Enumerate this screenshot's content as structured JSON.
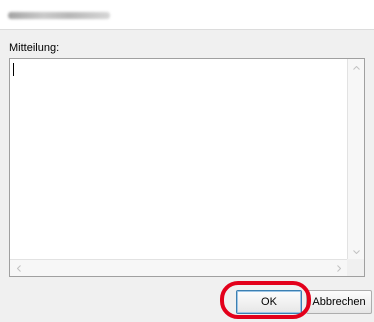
{
  "message_label": "Mitteilung:",
  "message_text": "",
  "buttons": {
    "ok_label": "OK",
    "cancel_label": "Abbrechen"
  },
  "colors": {
    "highlight": "#e3001b",
    "dialog_bg": "#f0f0f0"
  },
  "icons": {
    "scroll_up": "chevron-up-icon",
    "scroll_down": "chevron-down-icon",
    "scroll_left": "chevron-left-icon",
    "scroll_right": "chevron-right-icon"
  }
}
